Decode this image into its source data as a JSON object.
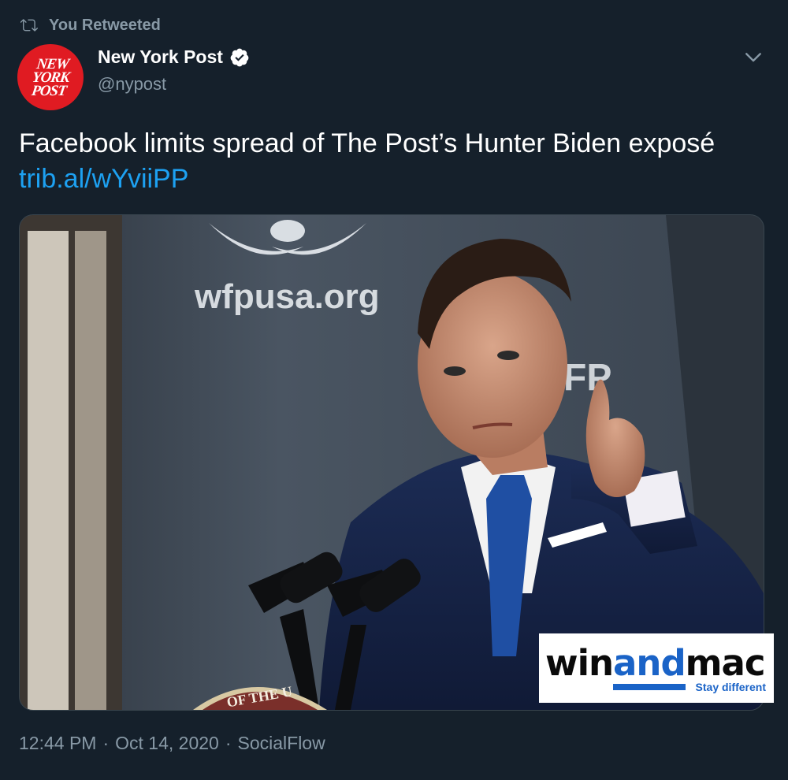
{
  "retweet": {
    "label": "You Retweeted",
    "icon": "retweet-icon"
  },
  "author": {
    "name": "New York Post",
    "handle": "@nypost",
    "verified": true,
    "avatar_logo_lines": [
      "NEW",
      "YORK",
      "POST"
    ]
  },
  "tweet": {
    "text": "Facebook limits spread of The Post’s Hunter Biden exposé",
    "link": "trib.al/wYviiPP"
  },
  "media": {
    "backdrop_text": "wfpusa.org",
    "backdrop_text_2": "FP",
    "podium_seal_text": "OF THE U"
  },
  "watermark": {
    "brand_left": "win",
    "brand_mid": "and",
    "brand_right": "mac",
    "tagline": "Stay different"
  },
  "meta": {
    "time": "12:44 PM",
    "date": "Oct 14, 2020",
    "source": "SocialFlow",
    "separator": "·"
  },
  "colors": {
    "background": "#15202b",
    "secondary_text": "#8899a6",
    "link": "#1da1f2",
    "avatar_red": "#e01b22"
  }
}
